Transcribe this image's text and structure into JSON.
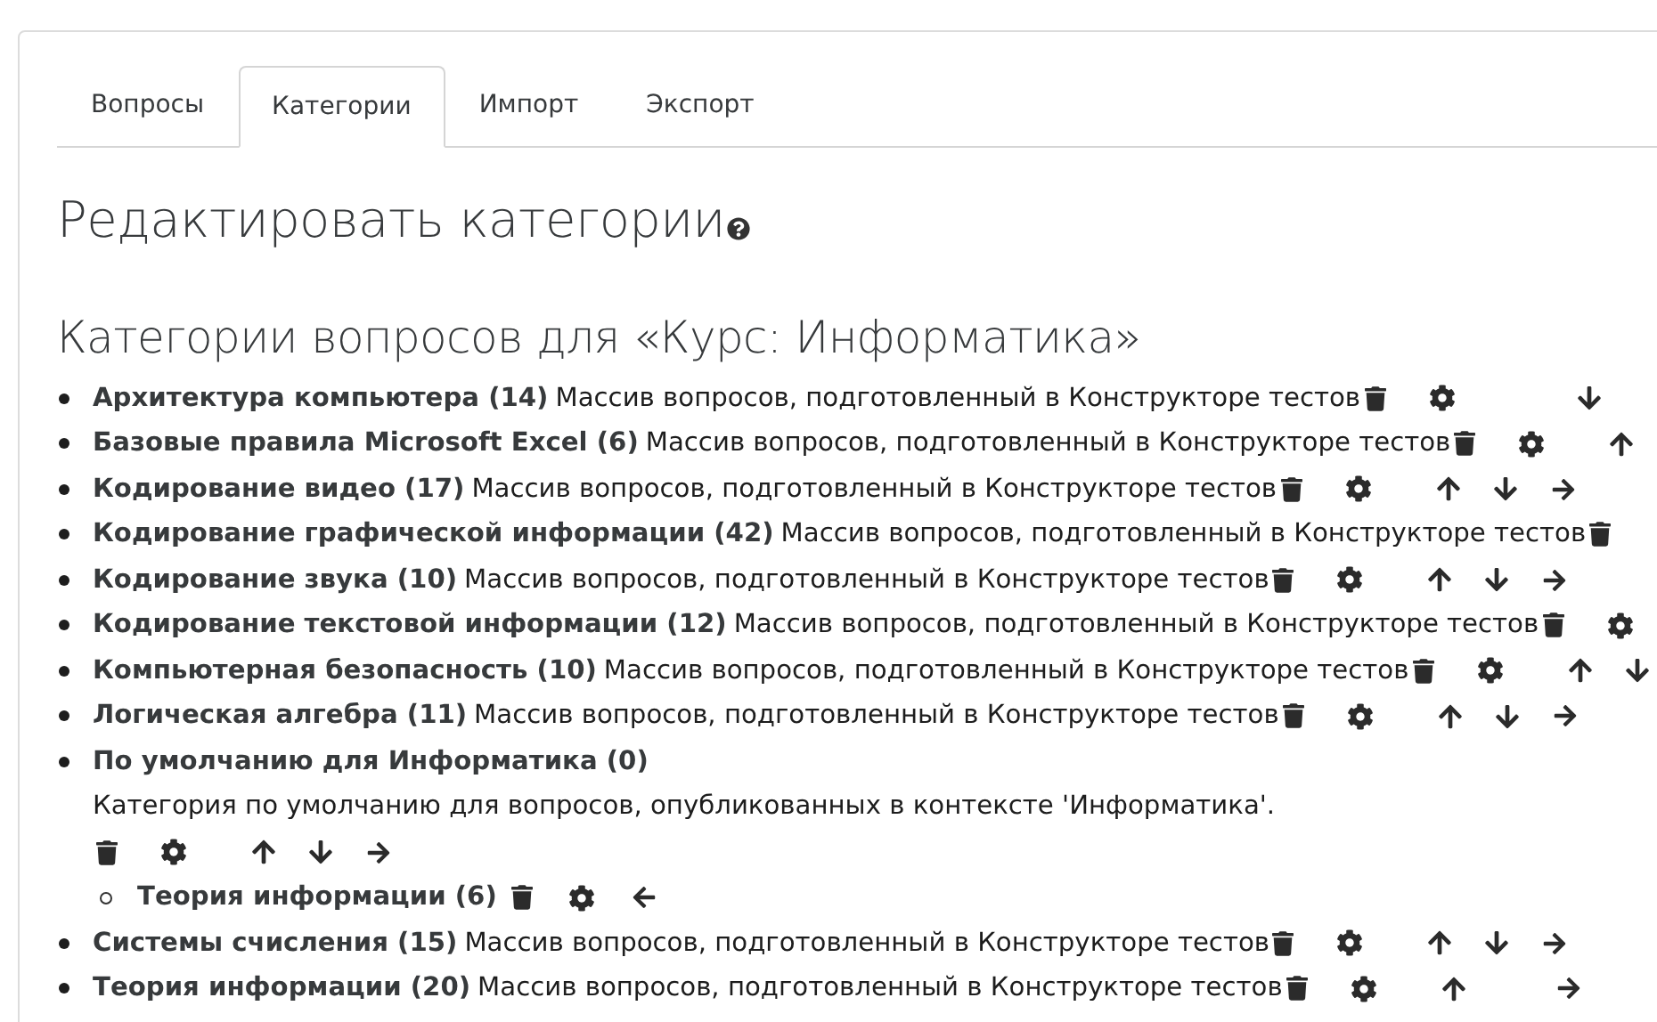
{
  "tabs": [
    {
      "label": "Вопросы",
      "selected": false
    },
    {
      "label": "Категории",
      "selected": true
    },
    {
      "label": "Импорт",
      "selected": false
    },
    {
      "label": "Экспорт",
      "selected": false
    }
  ],
  "heading": "Редактировать категории",
  "subheading": "Категории вопросов для «Курс: Информатика»",
  "categories": [
    {
      "kind": "inline",
      "name": "Архитектура компьютера (14)",
      "description": "Массив вопросов, подготовленный в Конструкторе тестов",
      "actions": [
        {
          "kind": "delete"
        },
        {
          "kind": "edit"
        },
        {
          "kind": "down"
        }
      ]
    },
    {
      "kind": "inline",
      "name": "Базовые правила Microsoft Excel (6)",
      "description": "Массив вопросов, подготовленный в Конструкторе тестов",
      "actions": [
        {
          "kind": "delete"
        },
        {
          "kind": "edit"
        },
        {
          "kind": "up"
        }
      ]
    },
    {
      "kind": "inline",
      "name": "Кодирование видео (17)",
      "description": "Массив вопросов, подготовленный в Конструкторе тестов",
      "actions": [
        {
          "kind": "delete"
        },
        {
          "kind": "edit"
        },
        {
          "kind": "up"
        },
        {
          "kind": "down"
        },
        {
          "kind": "right"
        }
      ]
    },
    {
      "kind": "inline",
      "name": "Кодирование графической информации (42)",
      "description": "Массив вопросов, подготовленный в Конструкторе тестов",
      "actions": [
        {
          "kind": "delete"
        }
      ]
    },
    {
      "kind": "inline",
      "name": "Кодирование звука (10)",
      "description": "Массив вопросов, подготовленный в Конструкторе тестов",
      "actions": [
        {
          "kind": "delete"
        },
        {
          "kind": "edit"
        },
        {
          "kind": "up"
        },
        {
          "kind": "down"
        },
        {
          "kind": "right"
        }
      ]
    },
    {
      "kind": "inline",
      "name": "Кодирование текстовой информации (12)",
      "description": "Массив вопросов, подготовленный в Конструкторе тестов",
      "actions": [
        {
          "kind": "delete"
        },
        {
          "kind": "edit"
        }
      ]
    },
    {
      "kind": "inline",
      "name": "Компьютерная безопасность (10)",
      "description": "Массив вопросов, подготовленный в Конструкторе тестов",
      "actions": [
        {
          "kind": "delete"
        },
        {
          "kind": "edit"
        },
        {
          "kind": "up"
        },
        {
          "kind": "down"
        }
      ]
    },
    {
      "kind": "inline",
      "name": "Логическая алгебра (11)",
      "description": "Массив вопросов, подготовленный в Конструкторе тестов",
      "actions": [
        {
          "kind": "delete"
        },
        {
          "kind": "edit"
        },
        {
          "kind": "up"
        },
        {
          "kind": "down"
        },
        {
          "kind": "right"
        }
      ]
    },
    {
      "kind": "block",
      "name": "По умолчанию для Информатика (0)",
      "description": "Категория по умолчанию для вопросов, опубликованных в контексте 'Информатика'.",
      "actions": [
        {
          "kind": "delete"
        },
        {
          "kind": "edit"
        },
        {
          "kind": "up"
        },
        {
          "kind": "down"
        },
        {
          "kind": "right"
        }
      ],
      "children": [
        {
          "kind": "compact",
          "name": "Теория информации (6)",
          "actions": [
            {
              "kind": "delete"
            },
            {
              "kind": "edit"
            },
            {
              "kind": "left"
            }
          ]
        }
      ]
    },
    {
      "kind": "inline",
      "name": "Системы счисления (15)",
      "description": "Массив вопросов, подготовленный в Конструкторе тестов",
      "actions": [
        {
          "kind": "delete"
        },
        {
          "kind": "edit"
        },
        {
          "kind": "up"
        },
        {
          "kind": "down"
        },
        {
          "kind": "right"
        }
      ]
    },
    {
      "kind": "inline",
      "name": "Теория информации (20)",
      "description": "Массив вопросов, подготовленный в Конструкторе тестов",
      "actions": [
        {
          "kind": "delete"
        },
        {
          "kind": "edit"
        },
        {
          "kind": "up"
        },
        {
          "kind": "right"
        }
      ]
    }
  ]
}
